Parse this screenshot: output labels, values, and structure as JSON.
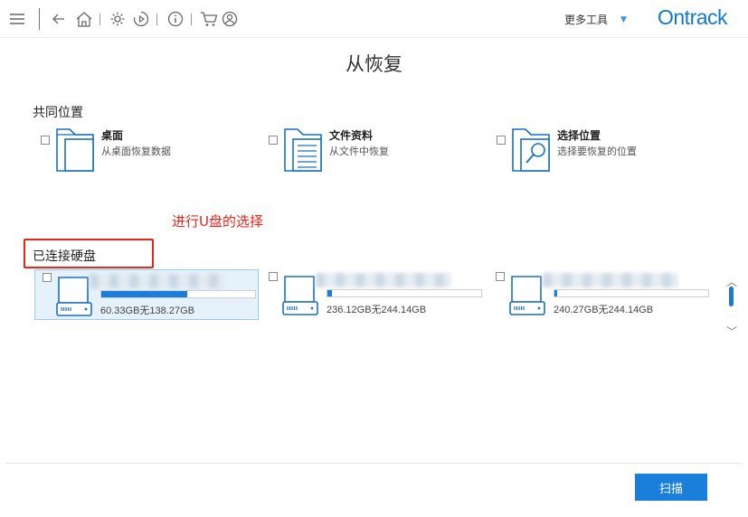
{
  "toolbar": {
    "icons": [
      "menu-icon",
      "back-arrow-icon",
      "home-icon",
      "settings-gear-icon",
      "play-icon",
      "info-icon",
      "cart-icon",
      "user-icon"
    ],
    "more_tools": "更多工具",
    "brand": "Ontrack"
  },
  "page": {
    "title": "从恢复"
  },
  "common_locations": {
    "label": "共同位置",
    "items": [
      {
        "name": "桌面",
        "desc": "从桌面恢复数据",
        "icon": "desktop-folder-icon"
      },
      {
        "name": "文件资料",
        "desc": "从文件中恢复",
        "icon": "documents-icon"
      },
      {
        "name": "选择位置",
        "desc": "选择要恢复的位置",
        "icon": "search-folder-icon"
      }
    ]
  },
  "annotation": "进行U盘的选择",
  "connected_drives": {
    "label": "已连接硬盘",
    "drives": [
      {
        "size": "60.33GB无138.27GB",
        "used_fraction": 0.56,
        "selected": true
      },
      {
        "size": "236.12GB无244.14GB",
        "used_fraction": 0.03,
        "selected": false
      },
      {
        "size": "240.27GB无244.14GB",
        "used_fraction": 0.02,
        "selected": false
      }
    ]
  },
  "footer": {
    "scan_label": "扫描"
  },
  "colors": {
    "accent": "#1a7fdb",
    "brand": "#1478c8",
    "annotation": "#e8241b"
  }
}
